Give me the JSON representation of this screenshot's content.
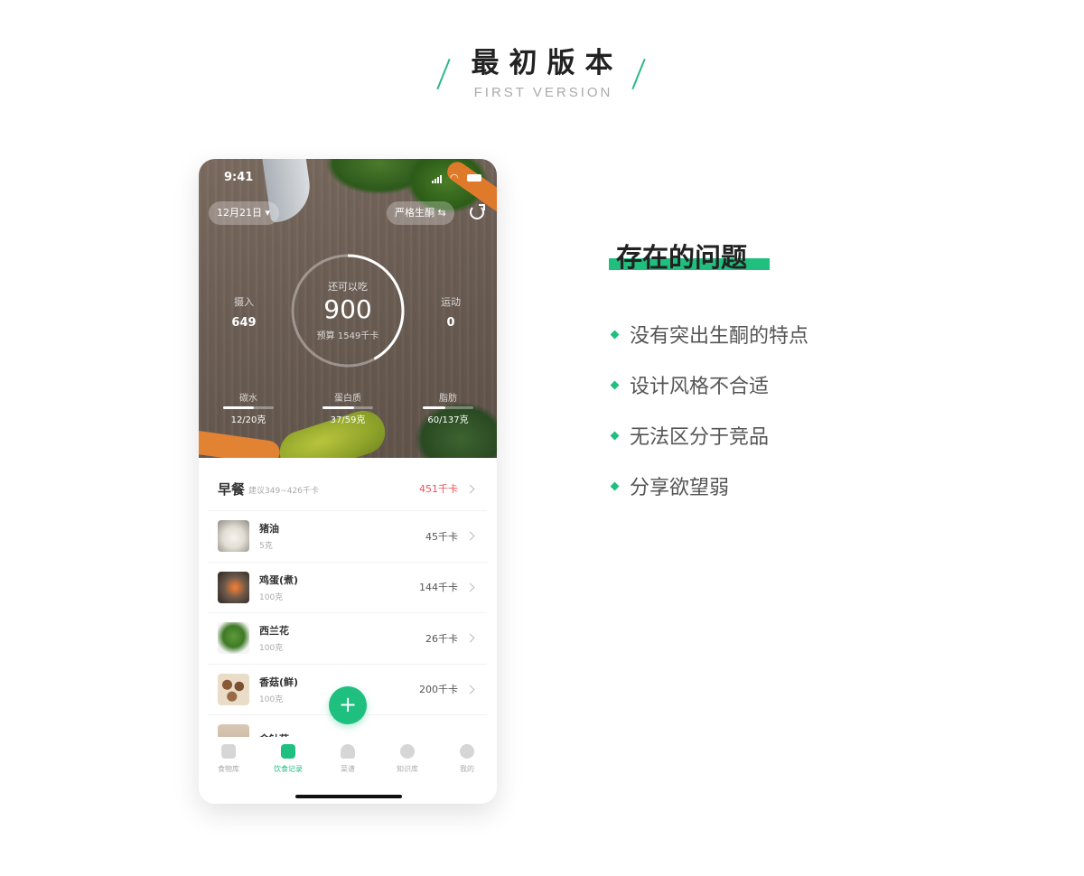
{
  "header": {
    "title": "最初版本",
    "subtitle": "FIRST VERSION"
  },
  "phone": {
    "status_time": "9:41",
    "date_pill": "12月21日 ▾",
    "mode_pill": "严格生酮 ⇆",
    "left_stat": {
      "label": "摄入",
      "value": "649"
    },
    "right_stat": {
      "label": "运动",
      "value": "0"
    },
    "ring": {
      "label": "还可以吃",
      "value": "900",
      "budget": "预算 1549千卡",
      "fraction": 0.42
    },
    "macros": [
      {
        "label": "碳水",
        "value": "12/20克",
        "fraction": 0.6
      },
      {
        "label": "蛋白质",
        "value": "37/59克",
        "fraction": 0.63
      },
      {
        "label": "脂肪",
        "value": "60/137克",
        "fraction": 0.44
      }
    ],
    "meal": {
      "name": "早餐",
      "hint": "建议349~426千卡",
      "kcal": "451千卡"
    },
    "foods": [
      {
        "name": "猪油",
        "amount": "5克",
        "kcal": "45千卡"
      },
      {
        "name": "鸡蛋(煮)",
        "amount": "100克",
        "kcal": "144千卡"
      },
      {
        "name": "西兰花",
        "amount": "100克",
        "kcal": "26千卡"
      },
      {
        "name": "香菇(鲜)",
        "amount": "100克",
        "kcal": "200千卡"
      },
      {
        "name": "金针菇",
        "amount": "",
        "kcal": ""
      }
    ],
    "fab": "+",
    "tabs": [
      {
        "label": "食物库",
        "icon": "fork-knife-icon"
      },
      {
        "label": "饮食记录",
        "icon": "record-book-icon"
      },
      {
        "label": "菜谱",
        "icon": "chef-hat-icon"
      },
      {
        "label": "知识库",
        "icon": "question-icon"
      },
      {
        "label": "我的",
        "icon": "profile-icon"
      }
    ],
    "active_tab": 1
  },
  "issues": {
    "title": "存在的问题",
    "items": [
      "没有突出生酮的特点",
      "设计风格不合适",
      "无法区分于竞品",
      "分享欲望弱"
    ]
  },
  "colors": {
    "accent": "#20bf7e",
    "alert": "#f0515a"
  }
}
